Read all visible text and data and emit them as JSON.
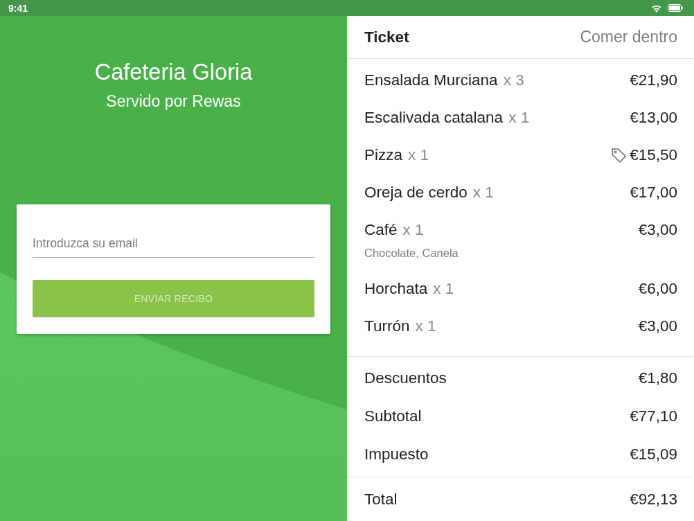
{
  "status_bar": {
    "time": "9:41"
  },
  "venue": {
    "name": "Cafeteria Gloria",
    "subtitle": "Servido por Rewas"
  },
  "receipt_form": {
    "email": {
      "placeholder": "Introduzca su email"
    },
    "send_button": {
      "label": "ENVIAR RECIBO",
      "disabled": true
    }
  },
  "ticket": {
    "title": "Ticket",
    "order_type": "Comer dentro",
    "items": [
      {
        "name": "Ensalada Murciana",
        "quantity": "x 3",
        "price": "€21,90",
        "discounted": false
      },
      {
        "name": "Escalivada catalana",
        "quantity": "x 1",
        "price": "€13,00",
        "discounted": false
      },
      {
        "name": "Pizza",
        "quantity": "x 1",
        "price": "€15,50",
        "discounted": true
      },
      {
        "name": "Oreja de cerdo",
        "quantity": "x 1",
        "price": "€17,00",
        "discounted": false
      },
      {
        "name": "Café",
        "quantity": "x 1",
        "price": "€3,00",
        "discounted": false,
        "modifiers": "Chocolate, Canela"
      },
      {
        "name": "Horchata",
        "quantity": "x 1",
        "price": "€6,00",
        "discounted": false
      },
      {
        "name": "Turrón",
        "quantity": "x 1",
        "price": "€3,00",
        "discounted": false
      }
    ],
    "summary": [
      {
        "label": "Descuentos",
        "value": "€1,80"
      },
      {
        "label": "Subtotal",
        "value": "€77,10"
      },
      {
        "label": "Impuesto",
        "value": "€15,09"
      }
    ],
    "total": {
      "label": "Total",
      "value": "€92,13"
    }
  }
}
